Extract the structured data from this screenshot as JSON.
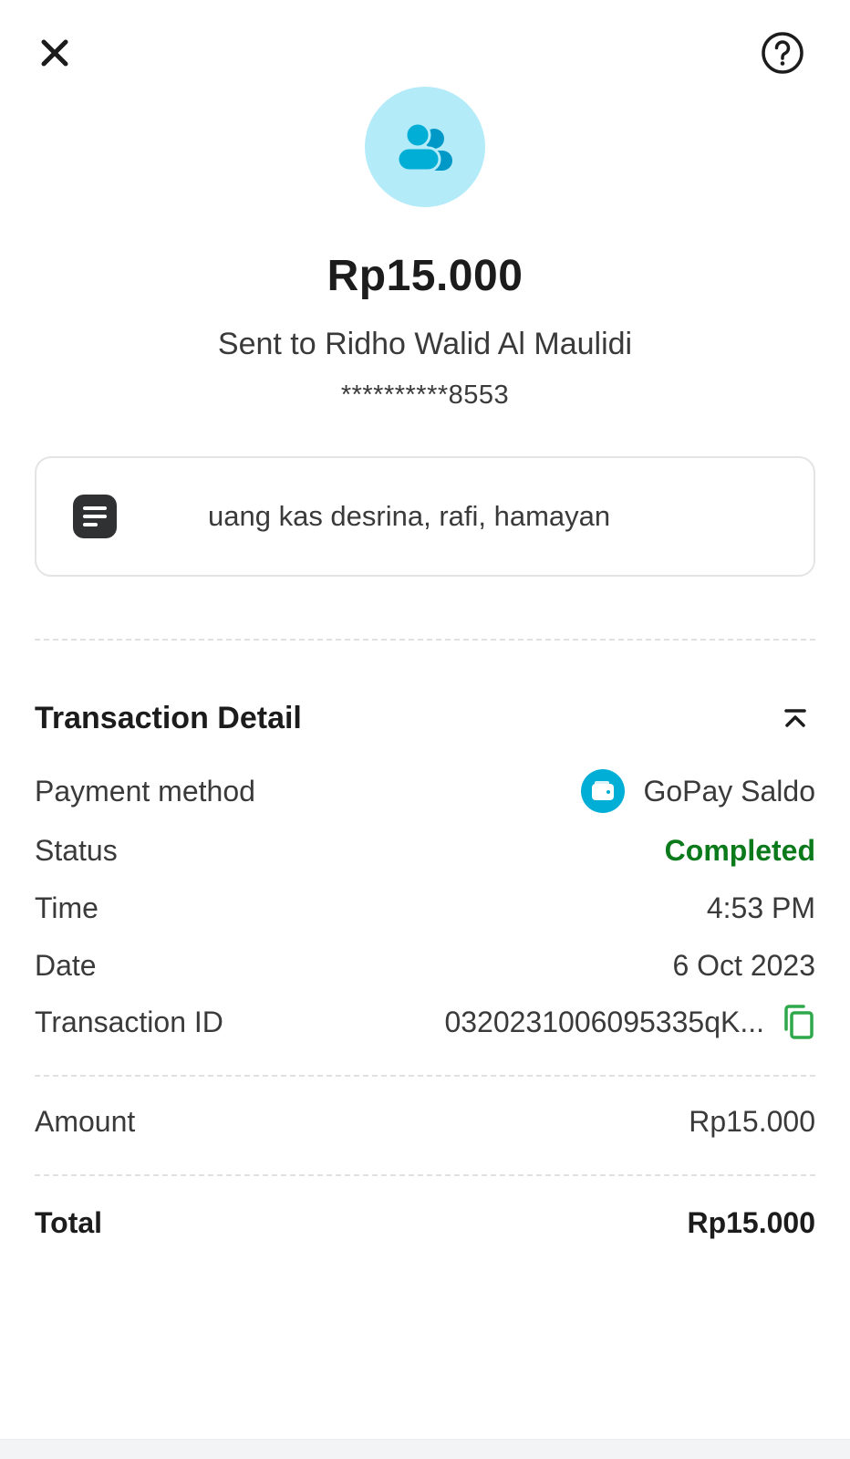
{
  "header": {
    "close_icon": "close-icon",
    "help_icon": "help-circle-icon"
  },
  "hero": {
    "recipient_icon": "users-icon",
    "amount": "Rp15.000",
    "sent_to": "Sent to Ridho Walid Al Maulidi",
    "account_masked": "**********8553"
  },
  "note": {
    "icon": "note-icon",
    "text": "uang kas desrina, rafi, hamayan"
  },
  "details": {
    "title": "Transaction Detail",
    "collapse_icon": "chevron-up-double-icon",
    "payment_method_label": "Payment method",
    "payment_method_value": "GoPay Saldo",
    "status_label": "Status",
    "status_value": "Completed",
    "time_label": "Time",
    "time_value": "4:53 PM",
    "date_label": "Date",
    "date_value": "6 Oct 2023",
    "txid_label": "Transaction ID",
    "txid_value": "0320231006095335qK...",
    "amount_label": "Amount",
    "amount_value": "Rp15.000",
    "total_label": "Total",
    "total_value": "Rp15.000"
  },
  "colors": {
    "accent": "#00aed6",
    "avatar_bg": "#b3ebf9",
    "status_completed": "#0b7a1b",
    "copy_icon": "#2ea84a"
  }
}
